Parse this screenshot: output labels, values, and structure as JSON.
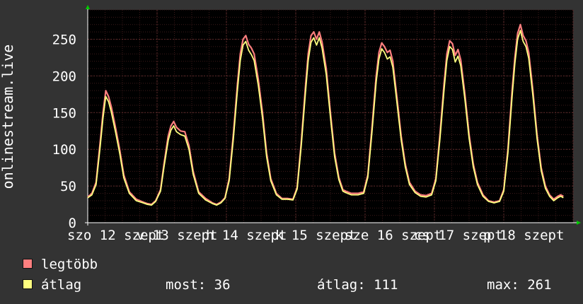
{
  "chart_data": {
    "type": "line",
    "ylabel": "onlinestream.live",
    "ylim": [
      0,
      290
    ],
    "yticks": [
      0,
      50,
      100,
      150,
      200,
      250
    ],
    "xlim": [
      0,
      7
    ],
    "grid": true,
    "xtick_labels": [
      {
        "x": 0.0,
        "label": "szo 12 szept"
      },
      {
        "x": 1.0,
        "label": "v 13 szept"
      },
      {
        "x": 2.0,
        "label": "h 14 szept"
      },
      {
        "x": 3.0,
        "label": "k 15 szept"
      },
      {
        "x": 4.0,
        "label": "sze 16 szept"
      },
      {
        "x": 5.0,
        "label": "cs 17 szept"
      },
      {
        "x": 6.0,
        "label": "p 18 szept"
      }
    ],
    "series": [
      {
        "name": "legtöbb",
        "color": "#ff7f7f",
        "points": [
          [
            0.0,
            35
          ],
          [
            0.06,
            40
          ],
          [
            0.12,
            55
          ],
          [
            0.18,
            110
          ],
          [
            0.22,
            150
          ],
          [
            0.26,
            180
          ],
          [
            0.3,
            172
          ],
          [
            0.34,
            158
          ],
          [
            0.4,
            130
          ],
          [
            0.46,
            100
          ],
          [
            0.52,
            65
          ],
          [
            0.6,
            42
          ],
          [
            0.7,
            32
          ],
          [
            0.8,
            28
          ],
          [
            0.86,
            26
          ],
          [
            0.92,
            25
          ],
          [
            0.98,
            30
          ],
          [
            1.05,
            45
          ],
          [
            1.1,
            80
          ],
          [
            1.16,
            118
          ],
          [
            1.2,
            132
          ],
          [
            1.24,
            138
          ],
          [
            1.28,
            130
          ],
          [
            1.34,
            125
          ],
          [
            1.4,
            124
          ],
          [
            1.46,
            105
          ],
          [
            1.52,
            70
          ],
          [
            1.6,
            42
          ],
          [
            1.7,
            33
          ],
          [
            1.8,
            27
          ],
          [
            1.86,
            25
          ],
          [
            1.92,
            28
          ],
          [
            1.98,
            34
          ],
          [
            2.04,
            60
          ],
          [
            2.1,
            120
          ],
          [
            2.16,
            190
          ],
          [
            2.2,
            230
          ],
          [
            2.24,
            250
          ],
          [
            2.28,
            255
          ],
          [
            2.32,
            243
          ],
          [
            2.36,
            238
          ],
          [
            2.4,
            230
          ],
          [
            2.46,
            195
          ],
          [
            2.52,
            150
          ],
          [
            2.58,
            95
          ],
          [
            2.64,
            60
          ],
          [
            2.72,
            40
          ],
          [
            2.8,
            33
          ],
          [
            2.88,
            33
          ],
          [
            2.96,
            32
          ],
          [
            3.02,
            48
          ],
          [
            3.08,
            110
          ],
          [
            3.14,
            185
          ],
          [
            3.18,
            230
          ],
          [
            3.22,
            255
          ],
          [
            3.26,
            260
          ],
          [
            3.3,
            250
          ],
          [
            3.34,
            260
          ],
          [
            3.38,
            246
          ],
          [
            3.44,
            210
          ],
          [
            3.5,
            150
          ],
          [
            3.56,
            95
          ],
          [
            3.62,
            62
          ],
          [
            3.68,
            45
          ],
          [
            3.72,
            43
          ],
          [
            3.8,
            40
          ],
          [
            3.9,
            40
          ],
          [
            3.98,
            42
          ],
          [
            4.04,
            65
          ],
          [
            4.1,
            130
          ],
          [
            4.16,
            200
          ],
          [
            4.2,
            232
          ],
          [
            4.24,
            245
          ],
          [
            4.28,
            240
          ],
          [
            4.32,
            232
          ],
          [
            4.36,
            235
          ],
          [
            4.4,
            220
          ],
          [
            4.46,
            170
          ],
          [
            4.52,
            118
          ],
          [
            4.58,
            80
          ],
          [
            4.64,
            55
          ],
          [
            4.72,
            43
          ],
          [
            4.8,
            38
          ],
          [
            4.88,
            37
          ],
          [
            4.96,
            40
          ],
          [
            5.02,
            60
          ],
          [
            5.08,
            120
          ],
          [
            5.14,
            190
          ],
          [
            5.18,
            230
          ],
          [
            5.22,
            248
          ],
          [
            5.26,
            244
          ],
          [
            5.3,
            228
          ],
          [
            5.34,
            236
          ],
          [
            5.38,
            222
          ],
          [
            5.44,
            175
          ],
          [
            5.5,
            120
          ],
          [
            5.56,
            80
          ],
          [
            5.62,
            55
          ],
          [
            5.7,
            38
          ],
          [
            5.78,
            30
          ],
          [
            5.86,
            28
          ],
          [
            5.94,
            30
          ],
          [
            6.0,
            45
          ],
          [
            6.06,
            100
          ],
          [
            6.12,
            180
          ],
          [
            6.16,
            225
          ],
          [
            6.2,
            258
          ],
          [
            6.24,
            270
          ],
          [
            6.28,
            255
          ],
          [
            6.32,
            248
          ],
          [
            6.36,
            232
          ],
          [
            6.42,
            180
          ],
          [
            6.48,
            120
          ],
          [
            6.54,
            75
          ],
          [
            6.6,
            50
          ],
          [
            6.66,
            38
          ],
          [
            6.72,
            32
          ],
          [
            6.78,
            36
          ],
          [
            6.82,
            38
          ],
          [
            6.86,
            36
          ]
        ]
      },
      {
        "name": "átlag",
        "color": "#ffff7f",
        "points": [
          [
            0.0,
            34
          ],
          [
            0.06,
            38
          ],
          [
            0.12,
            52
          ],
          [
            0.18,
            104
          ],
          [
            0.22,
            143
          ],
          [
            0.26,
            172
          ],
          [
            0.3,
            165
          ],
          [
            0.34,
            151
          ],
          [
            0.4,
            124
          ],
          [
            0.46,
            95
          ],
          [
            0.52,
            61
          ],
          [
            0.6,
            40
          ],
          [
            0.7,
            30
          ],
          [
            0.8,
            27
          ],
          [
            0.86,
            25
          ],
          [
            0.92,
            24
          ],
          [
            0.98,
            29
          ],
          [
            1.05,
            43
          ],
          [
            1.1,
            76
          ],
          [
            1.16,
            112
          ],
          [
            1.2,
            126
          ],
          [
            1.24,
            132
          ],
          [
            1.28,
            124
          ],
          [
            1.34,
            120
          ],
          [
            1.4,
            118
          ],
          [
            1.46,
            100
          ],
          [
            1.52,
            66
          ],
          [
            1.6,
            40
          ],
          [
            1.7,
            31
          ],
          [
            1.8,
            26
          ],
          [
            1.86,
            24
          ],
          [
            1.92,
            27
          ],
          [
            1.98,
            33
          ],
          [
            2.04,
            57
          ],
          [
            2.1,
            114
          ],
          [
            2.16,
            182
          ],
          [
            2.2,
            221
          ],
          [
            2.24,
            242
          ],
          [
            2.28,
            247
          ],
          [
            2.32,
            235
          ],
          [
            2.36,
            229
          ],
          [
            2.4,
            221
          ],
          [
            2.46,
            187
          ],
          [
            2.52,
            143
          ],
          [
            2.58,
            90
          ],
          [
            2.64,
            57
          ],
          [
            2.72,
            38
          ],
          [
            2.8,
            32
          ],
          [
            2.88,
            32
          ],
          [
            2.96,
            31
          ],
          [
            3.02,
            46
          ],
          [
            3.08,
            105
          ],
          [
            3.14,
            177
          ],
          [
            3.18,
            221
          ],
          [
            3.22,
            246
          ],
          [
            3.26,
            252
          ],
          [
            3.3,
            242
          ],
          [
            3.34,
            252
          ],
          [
            3.38,
            238
          ],
          [
            3.44,
            202
          ],
          [
            3.5,
            144
          ],
          [
            3.56,
            90
          ],
          [
            3.62,
            59
          ],
          [
            3.68,
            43
          ],
          [
            3.72,
            41
          ],
          [
            3.8,
            38
          ],
          [
            3.9,
            38
          ],
          [
            3.98,
            40
          ],
          [
            4.04,
            62
          ],
          [
            4.1,
            124
          ],
          [
            4.16,
            192
          ],
          [
            4.2,
            223
          ],
          [
            4.24,
            237
          ],
          [
            4.28,
            232
          ],
          [
            4.32,
            223
          ],
          [
            4.36,
            226
          ],
          [
            4.4,
            212
          ],
          [
            4.46,
            163
          ],
          [
            4.52,
            113
          ],
          [
            4.58,
            76
          ],
          [
            4.64,
            52
          ],
          [
            4.72,
            41
          ],
          [
            4.8,
            36
          ],
          [
            4.88,
            35
          ],
          [
            4.96,
            38
          ],
          [
            5.02,
            57
          ],
          [
            5.08,
            114
          ],
          [
            5.14,
            182
          ],
          [
            5.18,
            221
          ],
          [
            5.22,
            240
          ],
          [
            5.26,
            236
          ],
          [
            5.3,
            219
          ],
          [
            5.34,
            227
          ],
          [
            5.38,
            214
          ],
          [
            5.44,
            168
          ],
          [
            5.5,
            115
          ],
          [
            5.56,
            76
          ],
          [
            5.62,
            52
          ],
          [
            5.7,
            36
          ],
          [
            5.78,
            29
          ],
          [
            5.86,
            27
          ],
          [
            5.94,
            29
          ],
          [
            6.0,
            43
          ],
          [
            6.06,
            95
          ],
          [
            6.12,
            172
          ],
          [
            6.16,
            217
          ],
          [
            6.2,
            250
          ],
          [
            6.24,
            262
          ],
          [
            6.28,
            247
          ],
          [
            6.32,
            240
          ],
          [
            6.36,
            224
          ],
          [
            6.42,
            173
          ],
          [
            6.48,
            115
          ],
          [
            6.54,
            71
          ],
          [
            6.6,
            47
          ],
          [
            6.66,
            36
          ],
          [
            6.72,
            30
          ],
          [
            6.78,
            34
          ],
          [
            6.82,
            36
          ],
          [
            6.86,
            34
          ]
        ]
      }
    ],
    "legend": [
      {
        "label": "legtöbb",
        "color": "#ff7f7f"
      },
      {
        "label": "átlag",
        "color": "#ffff7f"
      }
    ],
    "stats": {
      "current": "most: 36",
      "average": "átlag: 111",
      "max": "max: 261"
    }
  }
}
